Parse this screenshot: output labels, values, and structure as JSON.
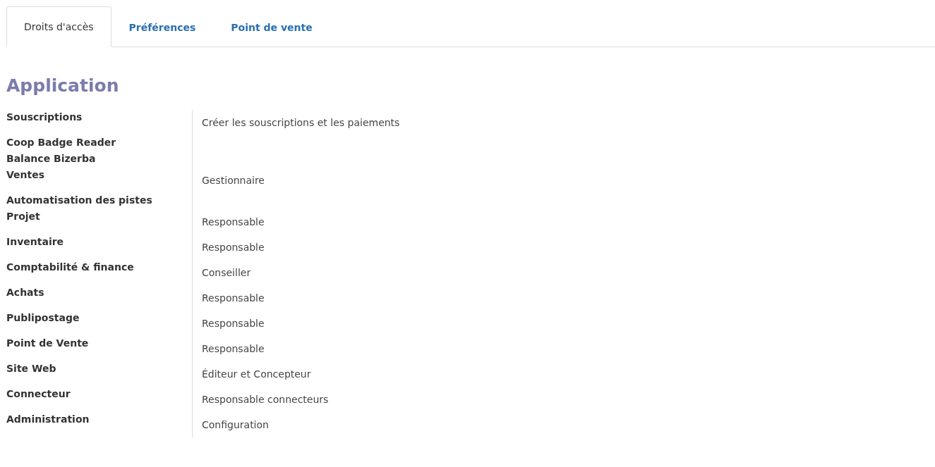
{
  "tabs": [
    {
      "label": "Droits d'accès",
      "selected": true
    },
    {
      "label": "Préférences",
      "selected": false
    },
    {
      "label": "Point de vente",
      "selected": false
    }
  ],
  "section": {
    "title": "Application"
  },
  "rows": [
    {
      "label": "Souscriptions",
      "value": "Créer les souscriptions et les paiements"
    },
    {
      "label": "Coop Badge Reader"
    },
    {
      "label": "Balance Bizerba"
    },
    {
      "label": "Ventes",
      "value": "Gestionnaire"
    },
    {
      "label": "Automatisation des pistes"
    },
    {
      "label": "Projet",
      "value": "Responsable"
    },
    {
      "label": "Inventaire",
      "value": "Responsable"
    },
    {
      "label": "Comptabilité & finance",
      "value": "Conseiller"
    },
    {
      "label": "Achats",
      "value": "Responsable"
    },
    {
      "label": "Publipostage",
      "value": "Responsable"
    },
    {
      "label": "Point de Vente",
      "value": "Responsable"
    },
    {
      "label": "Site Web",
      "value": "Éditeur et Concepteur"
    },
    {
      "label": "Connecteur",
      "value": "Responsable connecteurs"
    },
    {
      "label": "Administration",
      "value": "Configuration"
    }
  ]
}
